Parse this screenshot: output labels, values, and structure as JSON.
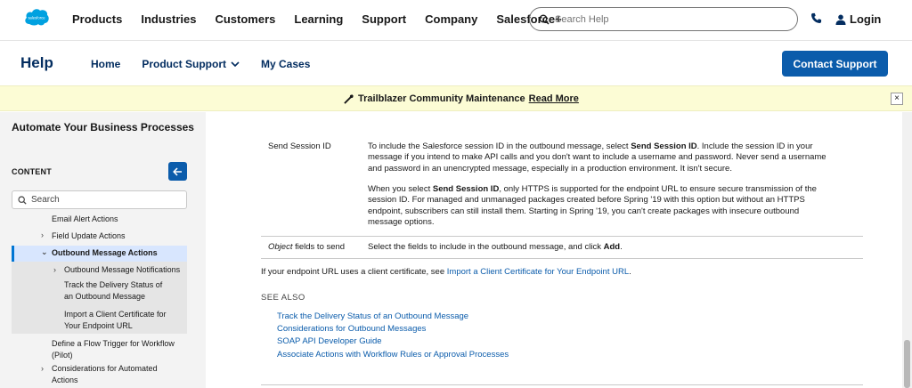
{
  "global_nav": {
    "logo_text": "salesforce",
    "items": [
      "Products",
      "Industries",
      "Customers",
      "Learning",
      "Support",
      "Company",
      "Salesforce+"
    ],
    "search_placeholder": "Search Help",
    "login_label": "Login"
  },
  "help_header": {
    "title": "Help",
    "nav": [
      "Home",
      "Product Support",
      "My Cases"
    ],
    "contact_button": "Contact Support"
  },
  "banner": {
    "text": "Trailblazer Community Maintenance",
    "link": "Read More",
    "close": "×"
  },
  "sidebar": {
    "title": "Automate Your Business Processes",
    "content_label": "CONTENT",
    "search_placeholder": "Search",
    "items": [
      {
        "label": "Email Alert Actions"
      },
      {
        "label": "Field Update Actions"
      },
      {
        "label": "Outbound Message Actions"
      },
      {
        "label": "Outbound Message Notifications"
      },
      {
        "label": "Track the Delivery Status of an Outbound Message"
      },
      {
        "label": "Import a Client Certificate for Your Endpoint URL"
      },
      {
        "label": "Define a Flow Trigger for Workflow (Pilot)"
      },
      {
        "label": "Considerations for Automated Actions"
      }
    ]
  },
  "main": {
    "session_row": {
      "label": "Send Session ID",
      "p1_a": "To include the Salesforce session ID in the outbound message, select ",
      "p1_b": "Send Session ID",
      "p1_c": ". Include the session ID in your message if you intend to make API calls and you don't want to include a username and password. Never send a username and password in an unencrypted message, especially in a production environment. It isn't secure.",
      "p2_a": "When you select ",
      "p2_b": "Send Session ID",
      "p2_c": ", only HTTPS is supported for the endpoint URL to ensure secure transmission of the session ID. For managed and unmanaged packages created before Spring '19 with this option but without an HTTPS endpoint, subscribers can still install them. Starting in Spring '19, you can't create packages with insecure outbound message options."
    },
    "object_row": {
      "label_em": "Object",
      "label_rest": " fields to send",
      "text_a": "Select the fields to include in the outbound message, and click ",
      "text_b": "Add",
      "text_c": "."
    },
    "cert_text": "If your endpoint URL uses a client certificate, see ",
    "cert_link": "Import a Client Certificate for Your Endpoint URL",
    "cert_end": ".",
    "see_also_title": "SEE ALSO",
    "see_also": [
      "Track the Delivery Status of an Outbound Message",
      "Considerations for Outbound Messages",
      "SOAP API Developer Guide",
      "Associate Actions with Workflow Rules or Approval Processes"
    ]
  },
  "colors": {
    "brand_blue": "#0b5cab",
    "nav_navy": "#032d60",
    "banner_bg": "#fcfcd5",
    "sidebar_bg": "#f3f3f3",
    "selected_bg": "#d8e6fe",
    "selected_border": "#0176d3"
  }
}
